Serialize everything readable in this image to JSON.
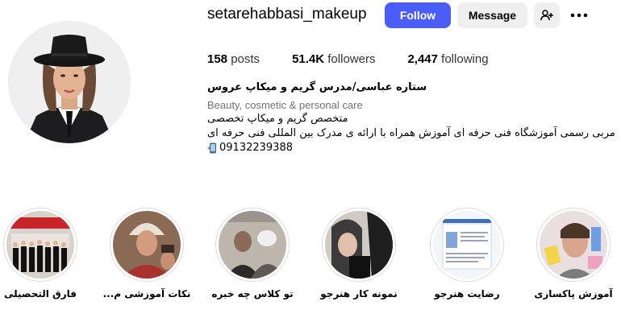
{
  "profile": {
    "username": "setarehabbasi_makeup",
    "follow_label": "Follow",
    "message_label": "Message",
    "more_icon": "more-icon",
    "suggest_icon": "add-user-icon"
  },
  "stats": {
    "posts_count": "158",
    "posts_label": "posts",
    "followers_count": "51.4K",
    "followers_label": "followers",
    "following_count": "2,447",
    "following_label": "following"
  },
  "bio": {
    "full_name": "ستاره عباسی/مدرس گریم و میکاپ عروس",
    "category": "Beauty, cosmetic & personal care",
    "line1": "متخصص گریم و میکاپ تخصصی",
    "line2": "مربی رسمی آموزشگاه فنی حرفه ای آموزش همراه با ارائه ی مدرک بین المللی فنی حرفه ای",
    "phone": "09132239388"
  },
  "highlights": [
    {
      "label": "فارق التحصیلی"
    },
    {
      "label": "نکات آموزشی م..."
    },
    {
      "label": "تو کلاس چه خبره"
    },
    {
      "label": "نمونه کار هنرجو"
    },
    {
      "label": "رضایت هنرجو"
    },
    {
      "label": "آموزش پاکسازی"
    }
  ],
  "colors": {
    "follow_bg": "#4a5df9",
    "secondary_bg": "#efefef",
    "ring": "#dbdbdb"
  }
}
